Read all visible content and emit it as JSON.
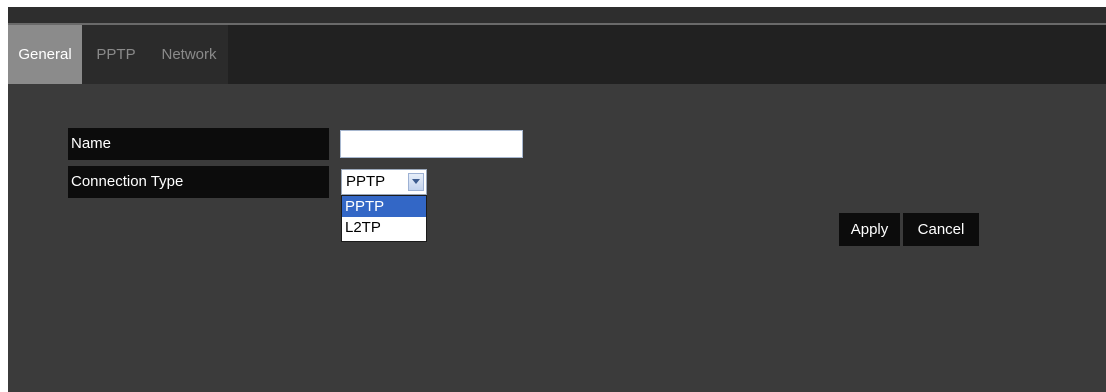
{
  "tabs": [
    {
      "label": "General",
      "active": true
    },
    {
      "label": "PPTP",
      "active": false
    },
    {
      "label": "Network",
      "active": false
    }
  ],
  "form": {
    "name_label": "Name",
    "name_value": "",
    "connection_type_label": "Connection Type",
    "connection_type_value": "PPTP",
    "connection_type_options": [
      "PPTP",
      "L2TP"
    ]
  },
  "actions": {
    "apply_label": "Apply",
    "cancel_label": "Cancel"
  },
  "colors": {
    "background": "#3b3b3b",
    "tabbar": "#212121",
    "active_tab": "#8b8b8b",
    "label_bg": "#0c0c0c",
    "option_highlight": "#3367c6"
  },
  "icons": {
    "select_arrow": "chevron-down-icon"
  }
}
